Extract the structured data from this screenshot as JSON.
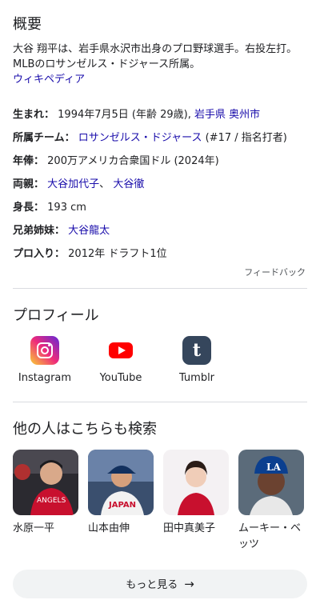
{
  "overview": {
    "title": "概要",
    "description": "大谷 翔平は、岩手県水沢市出身のプロ野球選手。右投左打。MLBのロサンゼルス・ドジャース所属。",
    "source_link": "ウィキペディア"
  },
  "facts": {
    "born": {
      "key": "生まれ：",
      "value": "1994年7月5日 (年齢 29歳), ",
      "link": "岩手県 奥州市"
    },
    "team": {
      "key": "所属チーム：",
      "link": "ロサンゼルス・ドジャース",
      "value": " (#17 / 指名打者)"
    },
    "salary": {
      "key": "年俸：",
      "value": "200万アメリカ合衆国ドル (2024年)"
    },
    "parents": {
      "key": "両親：",
      "link1": "大谷加代子",
      "sep": "、 ",
      "link2": "大谷徹"
    },
    "height": {
      "key": "身長：",
      "value": "193 cm"
    },
    "siblings": {
      "key": "兄弟姉妹：",
      "link": "大谷龍太"
    },
    "debut": {
      "key": "プロ入り：",
      "value": "2012年 ドラフト1位"
    }
  },
  "feedback": "フィードバック",
  "profiles": {
    "title": "プロフィール",
    "items": [
      {
        "label": "Instagram",
        "icon": "instagram-icon"
      },
      {
        "label": "YouTube",
        "icon": "youtube-icon"
      },
      {
        "label": "Tumblr",
        "icon": "tumblr-icon",
        "glyph": "t"
      }
    ]
  },
  "people": {
    "title": "他の人はこちらも検索",
    "items": [
      {
        "name": "水原一平"
      },
      {
        "name": "山本由伸"
      },
      {
        "name": "田中真美子"
      },
      {
        "name": "ムーキー・ベッツ"
      }
    ]
  },
  "more_button": {
    "label": "もっと見る",
    "arrow": "→"
  }
}
